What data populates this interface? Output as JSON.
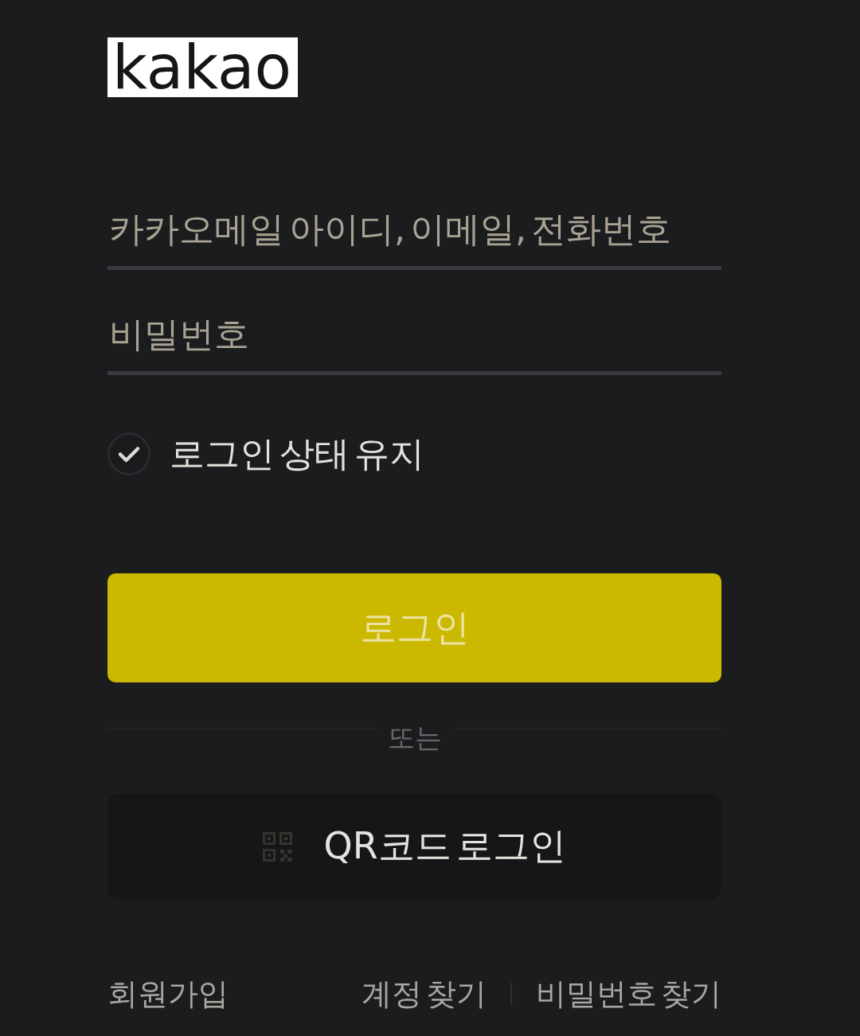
{
  "logo": {
    "text": "kakao"
  },
  "fields": [
    {
      "placeholder": "카카오메일 아이디, 이메일, 전화번호"
    },
    {
      "placeholder": "비밀번호"
    }
  ],
  "keep_signed_in": {
    "label": "로그인 상태 유지",
    "checked": false
  },
  "login_button": {
    "label": "로그인",
    "disabled": true
  },
  "divider": {
    "text": "또는"
  },
  "qr_button": {
    "label": "QR코드 로그인"
  },
  "footer": {
    "signup": "회원가입",
    "links": [
      "계정 찾기",
      "비밀번호 찾기"
    ]
  }
}
